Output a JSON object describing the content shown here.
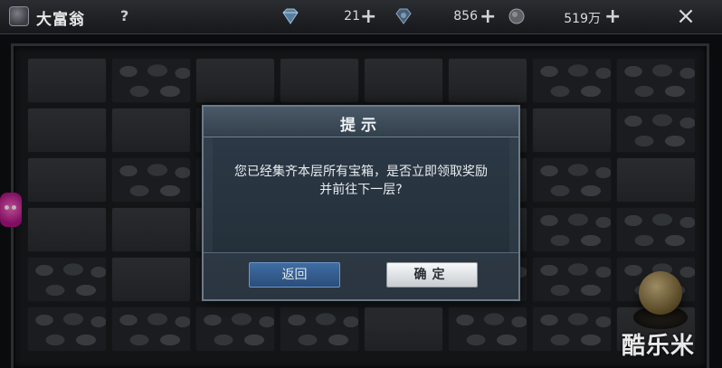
{
  "header": {
    "title": "大富翁",
    "help_label": "?",
    "close_icon": "×",
    "resources": [
      {
        "name": "diamond",
        "icon": "diamond-icon",
        "value": "21",
        "plus": "+"
      },
      {
        "name": "gem",
        "icon": "gem-icon",
        "value": "856",
        "plus": "+"
      },
      {
        "name": "coins",
        "icon": "coin-icon",
        "value": "519万",
        "plus": "+"
      }
    ]
  },
  "dialog": {
    "title": "提示",
    "message_line1": "您已经集齐本层所有宝箱，是否立即领取奖励",
    "message_line2": "并前往下一层?",
    "back_label": "返回",
    "confirm_label": "确定"
  },
  "watermark": "酷乐米",
  "colors": {
    "dialog_bg": "#2a3540",
    "back_button": "#2f5a8c",
    "confirm_button": "#e8eaec"
  }
}
